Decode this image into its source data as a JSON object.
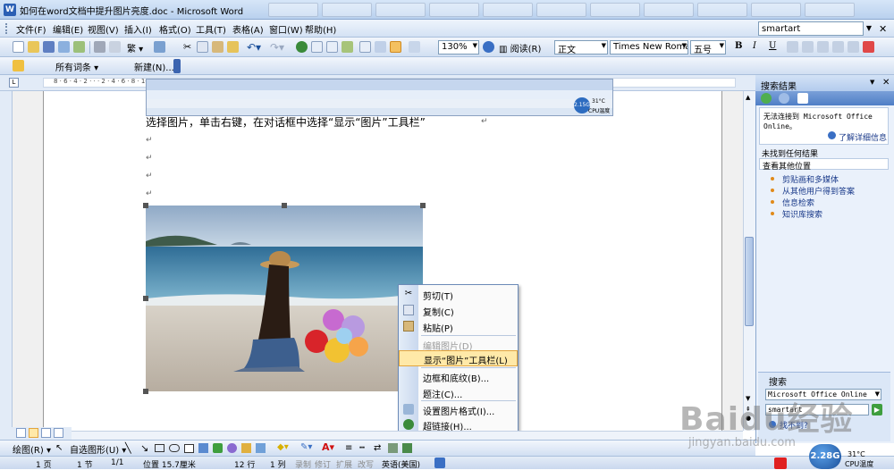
{
  "window": {
    "title": "如何在word文档中提升图片亮度.doc - Microsoft Word"
  },
  "menu": {
    "items": [
      "文件(F)",
      "编辑(E)",
      "视图(V)",
      "插入(I)",
      "格式(O)",
      "工具(T)",
      "表格(A)",
      "窗口(W)",
      "帮助(H)"
    ],
    "help_search": "smartart"
  },
  "toolbar": {
    "zoom": "130%",
    "read_label": "阅读(R)",
    "style": "正文",
    "font": "Times New Roman",
    "size": "五号",
    "bold": "B",
    "italic": "I",
    "underline": "U"
  },
  "toolbar2": {
    "emails": "所有词条",
    "new_label": "新建(N)..."
  },
  "document": {
    "line1": "选择图片，单击右键，在对话框中选择“显示“图片”工具栏”",
    "para_mark": "↵",
    "embed": {
      "temp": "31°C",
      "badge": "2.15G",
      "status": "CPU温度"
    }
  },
  "context_menu": {
    "items": [
      {
        "label": "剪切(T)",
        "icon": "scissors-icon",
        "disabled": false
      },
      {
        "label": "复制(C)",
        "icon": "copy-icon",
        "disabled": false
      },
      {
        "label": "粘贴(P)",
        "icon": "paste-icon",
        "disabled": false
      },
      {
        "label": "编辑图片(D)",
        "icon": "",
        "disabled": true
      },
      {
        "label": "显示“图片”工具栏(L)",
        "icon": "",
        "disabled": false,
        "highlighted": true
      },
      {
        "label": "边框和底纹(B)...",
        "icon": "",
        "disabled": false
      },
      {
        "label": "题注(C)...",
        "icon": "",
        "disabled": false
      },
      {
        "label": "设置图片格式(I)...",
        "icon": "format-picture-icon",
        "disabled": false
      },
      {
        "label": "超链接(H)...",
        "icon": "hyperlink-icon",
        "disabled": false
      }
    ]
  },
  "task_pane": {
    "title": "搜索结果",
    "no_connect": "无法连接到 Microsoft Office Online。",
    "learn_more": "了解详细信息",
    "no_results": "未找到任何结果",
    "other_places": "查看其他位置",
    "links": [
      "剪贴画和多媒体",
      "从其他用户得到答案",
      "信息检索",
      "知识库搜索"
    ],
    "search_label": "搜索",
    "scope": "Microsoft Office Online",
    "query": "smartart",
    "hint": "找不到?"
  },
  "draw_toolbar": {
    "draw": "绘图(R)",
    "autoshapes": "自选图形(U)"
  },
  "status_bar": {
    "page": "1 页",
    "section": "1 节",
    "pages": "1/1",
    "position": "位置 15.7厘米",
    "line": "12 行",
    "col": "1 列",
    "rec": "录制",
    "trk": "修订",
    "ext": "扩展",
    "ovr": "改写",
    "lang": "英语(美国)"
  },
  "system": {
    "cpu_badge": "2.28G",
    "temp": "31°C",
    "temp_label": "CPU温度"
  },
  "watermark": {
    "brand": "Baidu经验",
    "url": "jingyan.baidu.com"
  }
}
